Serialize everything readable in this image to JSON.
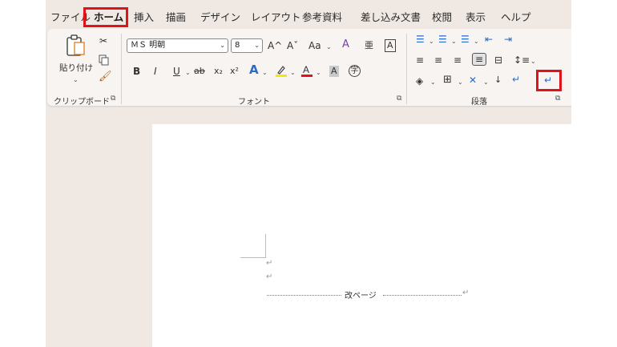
{
  "tabs": [
    "ファイル",
    "ホーム",
    "挿入",
    "描画",
    "デザイン",
    "レイアウト",
    "参考資料",
    "差し込み文書",
    "校閲",
    "表示",
    "ヘルプ"
  ],
  "active_tab": "ホーム",
  "clipboard": {
    "paste_label": "貼り付け",
    "group_label": "クリップボード"
  },
  "font": {
    "font_name": "ＭＳ 明朝",
    "font_size": "8",
    "group_label": "フォント",
    "grow_icon": "A^",
    "shrink_icon": "Aˇ",
    "change_case": "Aa",
    "bold": "B",
    "italic": "I",
    "underline": "U",
    "strike": "ab",
    "subscript": "x₂",
    "superscript": "x²",
    "phonetic": "亜",
    "charborder": "A",
    "charshade": "A",
    "enclosed": "字"
  },
  "paragraph": {
    "group_label": "段落"
  },
  "document": {
    "para_mark": "↵",
    "page_break_label": "改ページ"
  },
  "colors": {
    "highlight_red": "#e0121a",
    "app_bg": "#efe8e3"
  }
}
